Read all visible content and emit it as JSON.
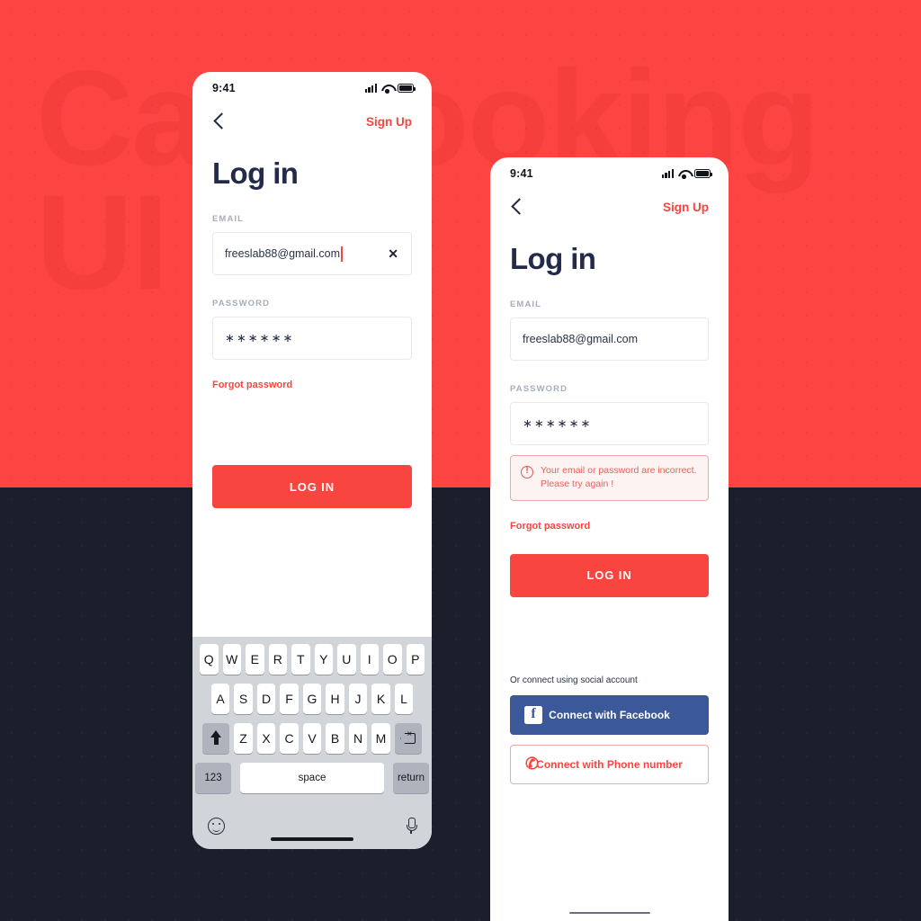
{
  "background": {
    "watermark_text": "Car Booking\nUI Kit",
    "red_color": "#fc4543",
    "dark_color": "#1b1e2b"
  },
  "common": {
    "status_time": "9:41",
    "signup_label": "Sign Up",
    "page_title": "Log in",
    "email_label": "EMAIL",
    "password_label": "PASSWORD",
    "email_value": "freeslab88@gmail.com",
    "password_value": "∗∗∗∗∗∗",
    "forgot_label": "Forgot password",
    "login_button": "LOG IN",
    "clear_icon": "✕",
    "accent_color": "#f8453f",
    "title_color": "#242b4a"
  },
  "phone1": {
    "keyboard": {
      "row1": [
        "Q",
        "W",
        "E",
        "R",
        "T",
        "Y",
        "U",
        "I",
        "O",
        "P"
      ],
      "row2": [
        "A",
        "S",
        "D",
        "F",
        "G",
        "H",
        "J",
        "K",
        "L"
      ],
      "row3": [
        "Z",
        "X",
        "C",
        "V",
        "B",
        "N",
        "M"
      ],
      "shift_label": "shift-key",
      "delete_label": "delete-key",
      "numbers_key": "123",
      "space_key": "space",
      "return_key": "return",
      "emoji_key": "emoji-key",
      "mic_key": "dictation-key"
    }
  },
  "phone2": {
    "error_message": "Your email or password are incorrect. Please try again !",
    "social_heading": "Or connect using social account",
    "facebook_button": "Connect with Facebook",
    "facebook_glyph": "f",
    "facebook_color": "#3b5998",
    "phone_button": "Connect with Phone number",
    "phone_glyph": "✆"
  }
}
